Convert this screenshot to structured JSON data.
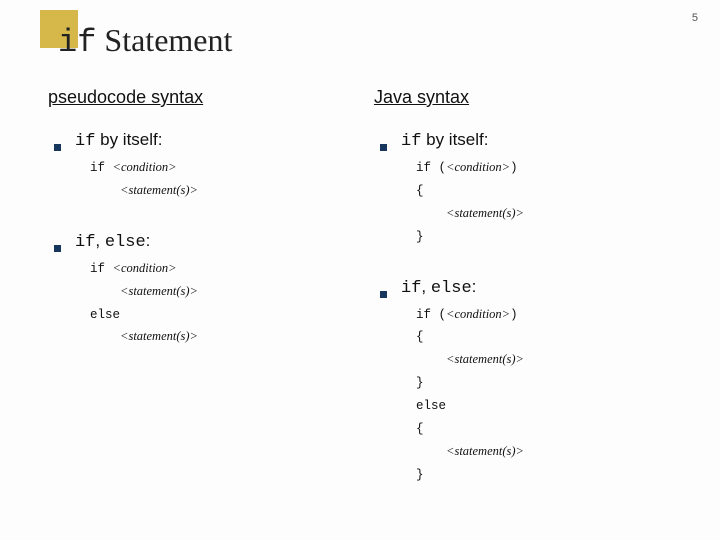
{
  "page_number": "5",
  "title_prefix": "if",
  "title_rest": " Statement",
  "left": {
    "heading": "pseudocode syntax",
    "b1_prefix": "if",
    "b1_rest": " by itself:",
    "c1_l1a": "if ",
    "c1_l1b": "<condition>",
    "c1_l2a": "    ",
    "c1_l2b": "<statement(s)>",
    "b2_prefix": "if",
    "b2_mid": ", ",
    "b2_mono2": "else",
    "b2_end": ":",
    "c2_l1a": "if ",
    "c2_l1b": "<condition>",
    "c2_l2a": "    ",
    "c2_l2b": "<statement(s)>",
    "c2_l3a": "else",
    "c2_l4a": "    ",
    "c2_l4b": "<statement(s)>"
  },
  "right": {
    "heading": "Java syntax",
    "b1_prefix": "if",
    "b1_rest": " by itself:",
    "c1_l1a": "if (",
    "c1_l1b": "<condition>",
    "c1_l1c": ")",
    "c1_l2": "{",
    "c1_l3a": "    ",
    "c1_l3b": "<statement(s)>",
    "c1_l4": "}",
    "b2_prefix": "if",
    "b2_mid": ", ",
    "b2_mono2": "else",
    "b2_end": ":",
    "c2_l1a": "if (",
    "c2_l1b": "<condition>",
    "c2_l1c": ")",
    "c2_l2": "{",
    "c2_l3a": "    ",
    "c2_l3b": "<statement(s)>",
    "c2_l4": "}",
    "c2_l5": "else",
    "c2_l6": "{",
    "c2_l7a": "    ",
    "c2_l7b": "<statement(s)>",
    "c2_l8": "}"
  }
}
